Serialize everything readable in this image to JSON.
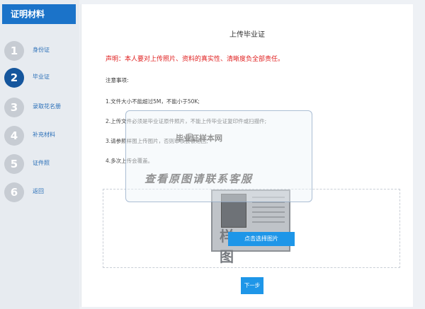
{
  "sidebar": {
    "title": "证明材料",
    "steps": [
      {
        "number": "1",
        "label": "身份证"
      },
      {
        "number": "2",
        "label": "毕业证"
      },
      {
        "number": "3",
        "label": "录取花名册"
      },
      {
        "number": "4",
        "label": "补充材料"
      },
      {
        "number": "5",
        "label": "证件照"
      },
      {
        "number": "6",
        "label": "返回"
      }
    ],
    "active_step": 2
  },
  "main": {
    "title": "上传毕业证",
    "declaration": "声明：本人要对上传照片、资料的真实性、清晰度负全部责任。",
    "notes_heading": "注意事项:",
    "notes": [
      "1.文件大小不能超过5M，不能小于50K;",
      "2.上传文件必须是毕业证原件照片，不能上传毕业证复印件或扫描件;",
      "3.请参照样图上传图片，否则审核会被退回;",
      "4.多次上传会覆盖。"
    ],
    "upload": {
      "sample_text": "样 图",
      "button_label": "点击选择图片"
    },
    "next_label": "下一步"
  },
  "watermark": {
    "brand": "毕业证样本网",
    "contact": "查看原图请联系客服"
  },
  "colors": {
    "primary": "#1b73c9",
    "active_step": "#15569d",
    "inactive_step": "#c7ccd3",
    "button": "#1e96e8",
    "warning": "#e02020"
  }
}
